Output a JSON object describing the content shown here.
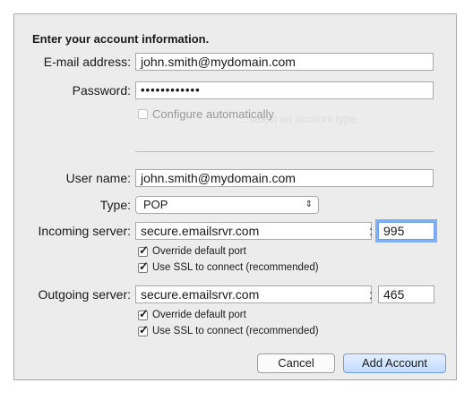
{
  "form": {
    "heading": "Enter your account information.",
    "email": {
      "label": "E-mail address:",
      "value": "john.smith@mydomain.com"
    },
    "password": {
      "label": "Password:",
      "value": "••••••••••••"
    },
    "configure_auto": {
      "label": "Configure automatically",
      "checked": false,
      "enabled": false
    },
    "username": {
      "label": "User name:",
      "value": "john.smith@mydomain.com"
    },
    "type": {
      "label": "Type:",
      "value": "POP"
    },
    "incoming": {
      "label": "Incoming server:",
      "server": "secure.emailsrvr.com",
      "port": "995",
      "override_port": {
        "label": "Override default port",
        "checked": true
      },
      "use_ssl": {
        "label": "Use SSL to connect (recommended)",
        "checked": true
      }
    },
    "outgoing": {
      "label": "Outgoing server:",
      "server": "secure.emailsrvr.com",
      "port": "465",
      "override_port": {
        "label": "Override default port",
        "checked": true
      },
      "use_ssl": {
        "label": "Use SSL to connect (recommended)",
        "checked": true
      }
    },
    "colon": ":"
  },
  "buttons": {
    "cancel": "Cancel",
    "add_account": "Add Account"
  },
  "colors": {
    "focus_ring": "#7fb0f5",
    "primary_button": "#c2dbff"
  }
}
